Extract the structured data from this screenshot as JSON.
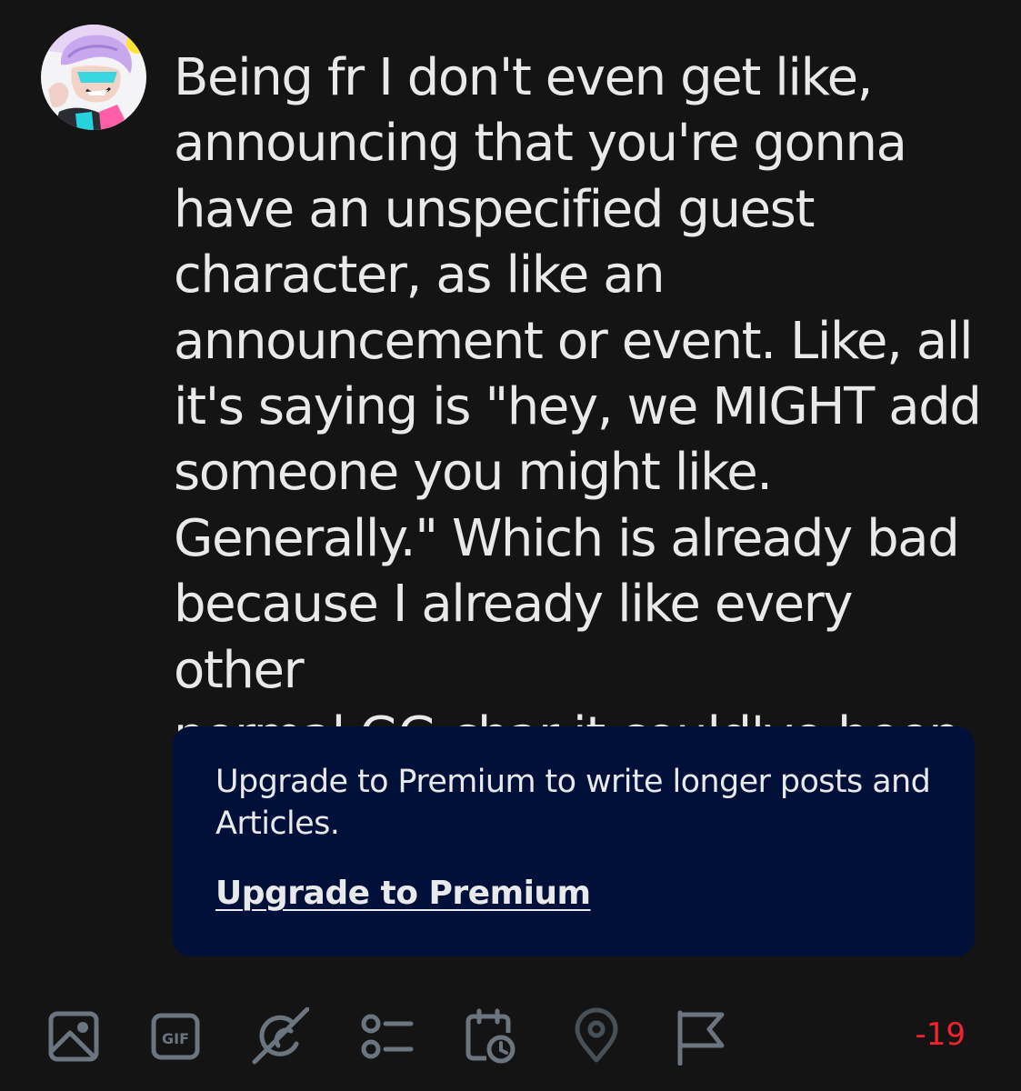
{
  "post": {
    "text": "Being fr I don't even get like,\nannouncing that you're gonna\nhave an unspecified guest\ncharacter, as like an\nannouncement or event. Like, all\nit's saying is \"hey, we MIGHT add\nsomeone you might like.\nGenerally.\" Which is already bad\nbecause I already like every other\nnormal GG char it could've been"
  },
  "premium": {
    "message": "Upgrade to Premium to write longer posts and Articles.",
    "link_label": "Upgrade to Premium"
  },
  "toolbar": {
    "icons": [
      "image-icon",
      "gif-icon",
      "grok-icon",
      "poll-icon",
      "schedule-icon",
      "location-icon",
      "flag-icon"
    ],
    "gif_label": "GIF",
    "char_count": "-19"
  },
  "colors": {
    "background": "#141414",
    "text": "#e7e9ea",
    "premium_box": "#011039",
    "icon": "#6a7580",
    "over_limit": "#f4212e"
  }
}
